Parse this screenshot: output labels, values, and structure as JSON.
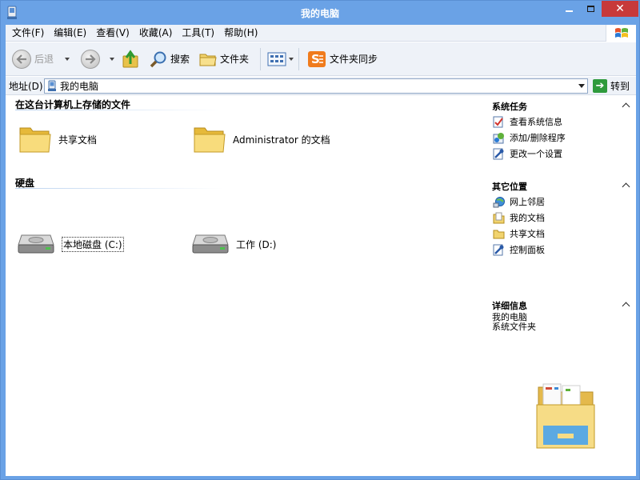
{
  "window": {
    "title": "我的电脑"
  },
  "menu": [
    {
      "label": "文件(F)"
    },
    {
      "label": "编辑(E)"
    },
    {
      "label": "查看(V)"
    },
    {
      "label": "收藏(A)"
    },
    {
      "label": "工具(T)"
    },
    {
      "label": "帮助(H)"
    }
  ],
  "toolbar": {
    "back_label": "后退",
    "search_label": "搜索",
    "folders_label": "文件夹",
    "sync_label": "文件夹同步"
  },
  "address": {
    "label": "地址(D)",
    "value": "我的电脑",
    "go_label": "转到"
  },
  "groups": {
    "stored": {
      "title": "在这台计算机上存储的文件",
      "items": [
        {
          "label": "共享文档",
          "icon": "folder-icon"
        },
        {
          "label": "Administrator 的文档",
          "icon": "folder-icon"
        }
      ]
    },
    "drives": {
      "title": "硬盘",
      "items": [
        {
          "label": "本地磁盘 (C:)",
          "icon": "hard-drive-icon"
        },
        {
          "label": "工作 (D:)",
          "icon": "hard-drive-icon"
        }
      ]
    }
  },
  "tasks": {
    "system": {
      "title": "系统任务",
      "links": [
        {
          "label": "查看系统信息",
          "icon": "system-info-icon"
        },
        {
          "label": "添加/删除程序",
          "icon": "add-remove-icon"
        },
        {
          "label": "更改一个设置",
          "icon": "settings-icon"
        }
      ]
    },
    "other": {
      "title": "其它位置",
      "links": [
        {
          "label": "网上邻居",
          "icon": "network-icon"
        },
        {
          "label": "我的文档",
          "icon": "documents-icon"
        },
        {
          "label": "共享文档",
          "icon": "folder-icon"
        },
        {
          "label": "控制面板",
          "icon": "control-panel-icon"
        }
      ]
    },
    "details": {
      "title": "详细信息",
      "line1": "我的电脑",
      "line2": "系统文件夹"
    }
  },
  "colors": {
    "frame": "#6aa2e6",
    "close": "#c7393a",
    "bar_bg": "#eef2f8",
    "go_green": "#2e9a3c"
  }
}
